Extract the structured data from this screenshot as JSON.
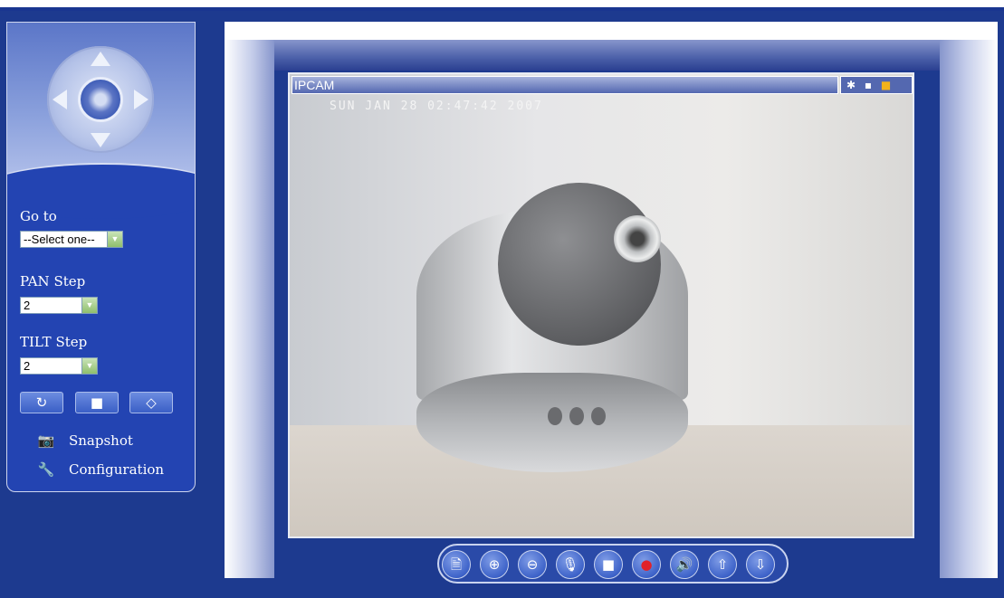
{
  "panel": {
    "goto_label": "Go to",
    "goto_value": "--Select one--",
    "pan_label": "PAN Step",
    "pan_value": "2",
    "tilt_label": "TILT Step",
    "tilt_value": "2",
    "snapshot_label": "Snapshot",
    "config_label": "Configuration"
  },
  "video": {
    "title": "IPCAM",
    "timestamp": "SUN JAN 28 02:47:42 2007"
  },
  "icons": {
    "up": "arrow-up-icon",
    "down": "arrow-down-icon",
    "left": "arrow-left-icon",
    "right": "arrow-right-icon",
    "snapshot": "camera-icon",
    "configuration": "wrench-icon",
    "controls": [
      "snapshot-file-icon",
      "zoom-in-icon",
      "zoom-out-icon",
      "microphone-icon",
      "stop-icon",
      "record-icon",
      "speaker-icon",
      "talk-up-icon",
      "talk-down-icon"
    ]
  },
  "colors": {
    "background": "#1d3a8f",
    "panel": "#2344b2",
    "record": "#e0222a"
  }
}
